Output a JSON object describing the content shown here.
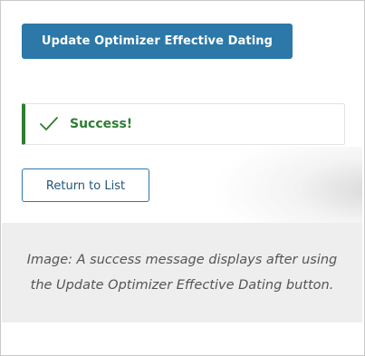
{
  "panel": {
    "update_button_label": "Update Optimizer Effective Dating",
    "success_message": "Success!",
    "return_button_label": "Return to List"
  },
  "caption": {
    "text": "Image: A success message displays after using the Update Optimizer Effective Dating button."
  },
  "icons": {
    "success": "check-icon"
  },
  "colors": {
    "primary_button": "#2b78a9",
    "success": "#2e7d32",
    "caption_background": "#eeeeee"
  }
}
